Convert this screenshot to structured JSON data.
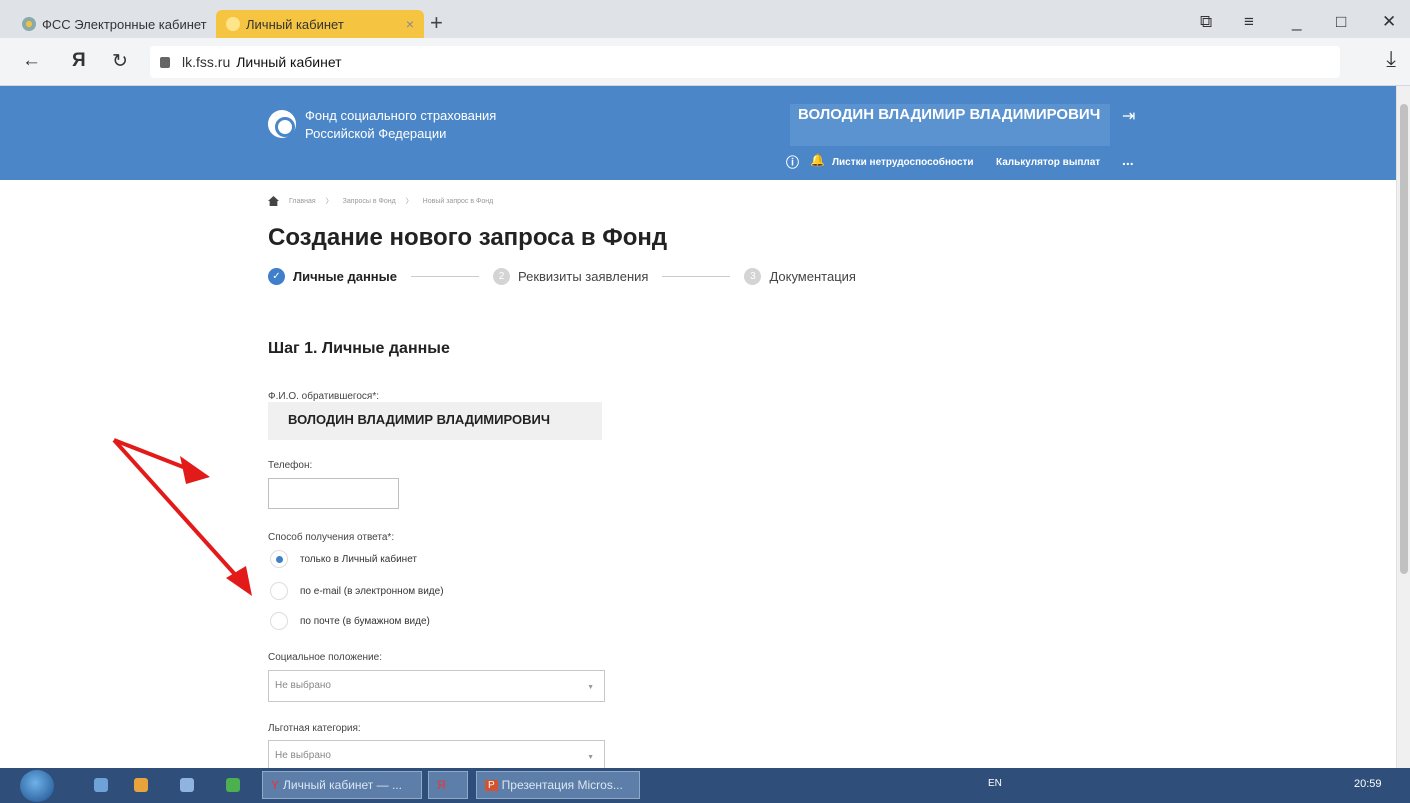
{
  "browser": {
    "tabs": [
      {
        "label": "ФСС Электронные кабинет",
        "active": false
      },
      {
        "label": "Личный кабинет",
        "active": true
      }
    ],
    "new_tab": "+",
    "close_tab": "×",
    "url_host": "lk.fss.ru",
    "page_title": "Личный кабинет"
  },
  "header": {
    "org_name": "Фонд социального страхования Российской Федерации",
    "user_name": "ВОЛОДИН ВЛАДИМИР ВЛАДИМИРОВИЧ",
    "nav": [
      "Листки нетрудоспособности",
      "Калькулятор выплат"
    ],
    "more": "..."
  },
  "breadcrumb": [
    "Главная",
    "Запросы в Фонд",
    "Новый запрос в Фонд"
  ],
  "page_heading": "Создание нового запроса в Фонд",
  "steps": [
    {
      "num": "1",
      "label": "Личные данные",
      "status": "done"
    },
    {
      "num": "2",
      "label": "Реквизиты заявления",
      "status": "todo"
    },
    {
      "num": "3",
      "label": "Документация",
      "status": "todo"
    }
  ],
  "form": {
    "section_title": "Шаг 1. Личные данные",
    "fio_label": "Ф.И.О. обратившегося*:",
    "fio_value": "ВОЛОДИН ВЛАДИМИР ВЛАДИМИРОВИЧ",
    "phone_label": "Телефон:",
    "phone_value": "",
    "response_label": "Способ получения ответа*:",
    "response_options": [
      {
        "label": "только в Личный кабинет",
        "selected": true
      },
      {
        "label": "по e-mail (в электронном виде)",
        "selected": false
      },
      {
        "label": "по почте (в бумажном виде)",
        "selected": false
      }
    ],
    "social_label": "Социальное положение:",
    "social_value": "Не выбрано",
    "benefit_label": "Льготная категория:",
    "benefit_value": "Не выбрано"
  },
  "taskbar": {
    "buttons": [
      "Личный кабинет — ...",
      "Презентация Micros..."
    ],
    "lang": "EN",
    "clock": "20:59"
  },
  "colors": {
    "header_blue": "#4a86c8",
    "step_active": "#3f7fcb",
    "annotation_arrow": "#e21a1a"
  }
}
